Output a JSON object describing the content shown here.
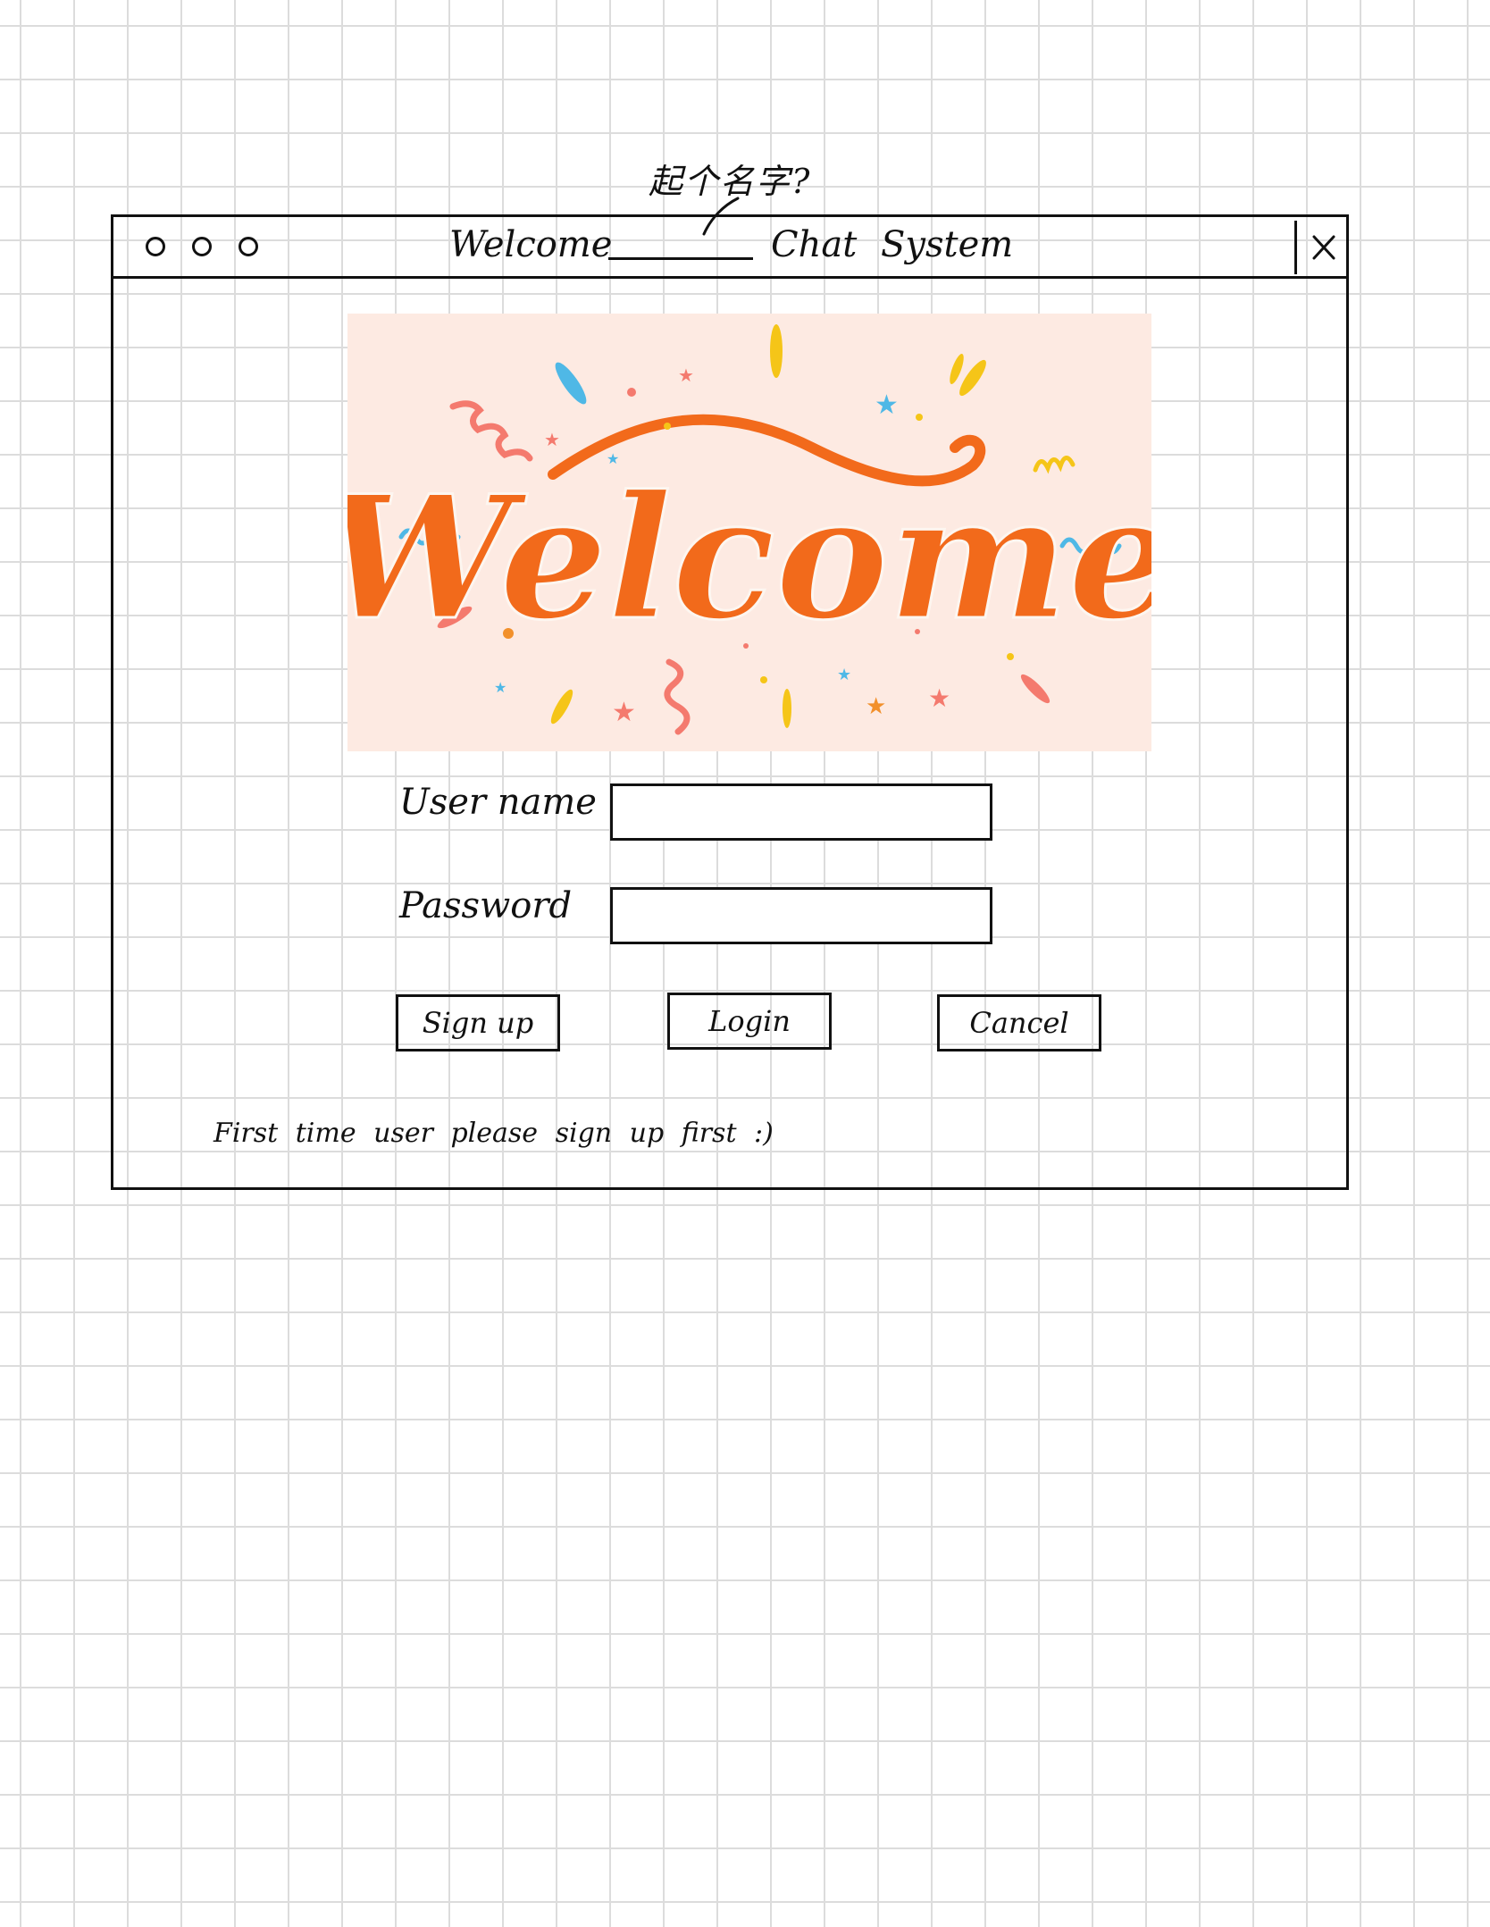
{
  "annotation": {
    "text": "起个名字?"
  },
  "window": {
    "title_left": "Welcome",
    "title_right": "Chat System",
    "close_glyph": "✕",
    "icons": {
      "close": "close-icon",
      "traffic_lights": "window-control-dot"
    }
  },
  "banner": {
    "text": "Welcome",
    "colors": {
      "background": "#fdeae2",
      "lettering": "#f26a1b",
      "accent_blue": "#4fb8e6",
      "accent_yellow": "#f5c518",
      "accent_pink": "#f47a6e"
    }
  },
  "form": {
    "username_label": "User name",
    "username_value": "",
    "password_label": "Password",
    "password_value": ""
  },
  "buttons": {
    "signup": "Sign up",
    "login": "Login",
    "cancel": "Cancel"
  },
  "hint": "First time user please sign up first :)"
}
